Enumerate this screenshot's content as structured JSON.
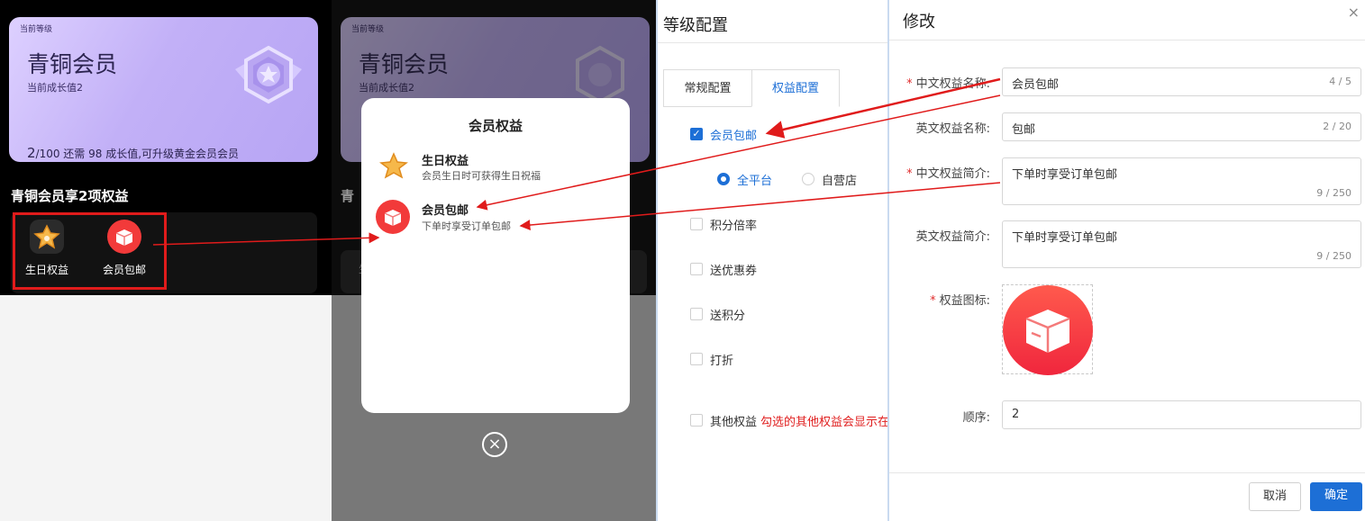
{
  "panel1": {
    "card": {
      "level_label": "当前等级",
      "level_name": "青铜会员",
      "growth": "当前成长值2",
      "progress_current": "2",
      "progress_text": "/100 还需 98 成长值,可升级黄金会员会员",
      "progress_fraction": 0.02
    },
    "benefits_title": "青铜会员享2项权益",
    "benefits": [
      {
        "label": "生日权益",
        "icon": "star-icon"
      },
      {
        "label": "会员包邮",
        "icon": "box-icon"
      }
    ]
  },
  "panel2": {
    "card": {
      "level_label": "当前等级",
      "level_name": "青铜会员",
      "growth": "当前成长值2"
    },
    "benefits_title_partial": "青",
    "strip_partial": "生",
    "modal": {
      "title": "会员权益",
      "items": [
        {
          "title": "生日权益",
          "desc": "会员生日时可获得生日祝福",
          "icon": "star-icon"
        },
        {
          "title": "会员包邮",
          "desc": "下单时享受订单包邮",
          "icon": "box-icon"
        }
      ]
    }
  },
  "panel3": {
    "title": "等级配置",
    "tabs": [
      {
        "label": "常规配置",
        "active": false
      },
      {
        "label": "权益配置",
        "active": true
      }
    ],
    "options": [
      {
        "label": "会员包邮",
        "checked": true
      },
      {
        "label": "积分倍率",
        "checked": false
      },
      {
        "label": "送优惠券",
        "checked": false
      },
      {
        "label": "送积分",
        "checked": false
      },
      {
        "label": "打折",
        "checked": false
      },
      {
        "label": "其他权益",
        "checked": false
      }
    ],
    "radios": [
      {
        "label": "全平台",
        "checked": true
      },
      {
        "label": "自营店",
        "checked": false
      }
    ],
    "other_hint": "勾选的其他权益会显示在"
  },
  "panel4": {
    "title": "修改",
    "close": "×",
    "fields": {
      "cn_name": {
        "label": "中文权益名称:",
        "value": "会员包邮",
        "count": "4 / 5",
        "required": true
      },
      "en_name": {
        "label": "英文权益名称:",
        "value": "包邮",
        "count": "2 / 20",
        "required": false
      },
      "cn_desc": {
        "label": "中文权益简介:",
        "value": "下单时享受订单包邮",
        "count": "9 / 250",
        "required": true
      },
      "en_desc": {
        "label": "英文权益简介:",
        "value": "下单时享受订单包邮",
        "count": "9 / 250",
        "required": false
      },
      "icon": {
        "label": "权益图标:",
        "required": true,
        "icon": "box-icon"
      },
      "order": {
        "label": "顺序:",
        "value": "2"
      }
    },
    "cancel_label": "取消",
    "confirm_label": "确定"
  },
  "colors": {
    "accent": "#1d6fd6",
    "annotation_red": "#e01b1b",
    "card_purple": "#c2b0f7",
    "icon_red": "#f23a3a"
  }
}
